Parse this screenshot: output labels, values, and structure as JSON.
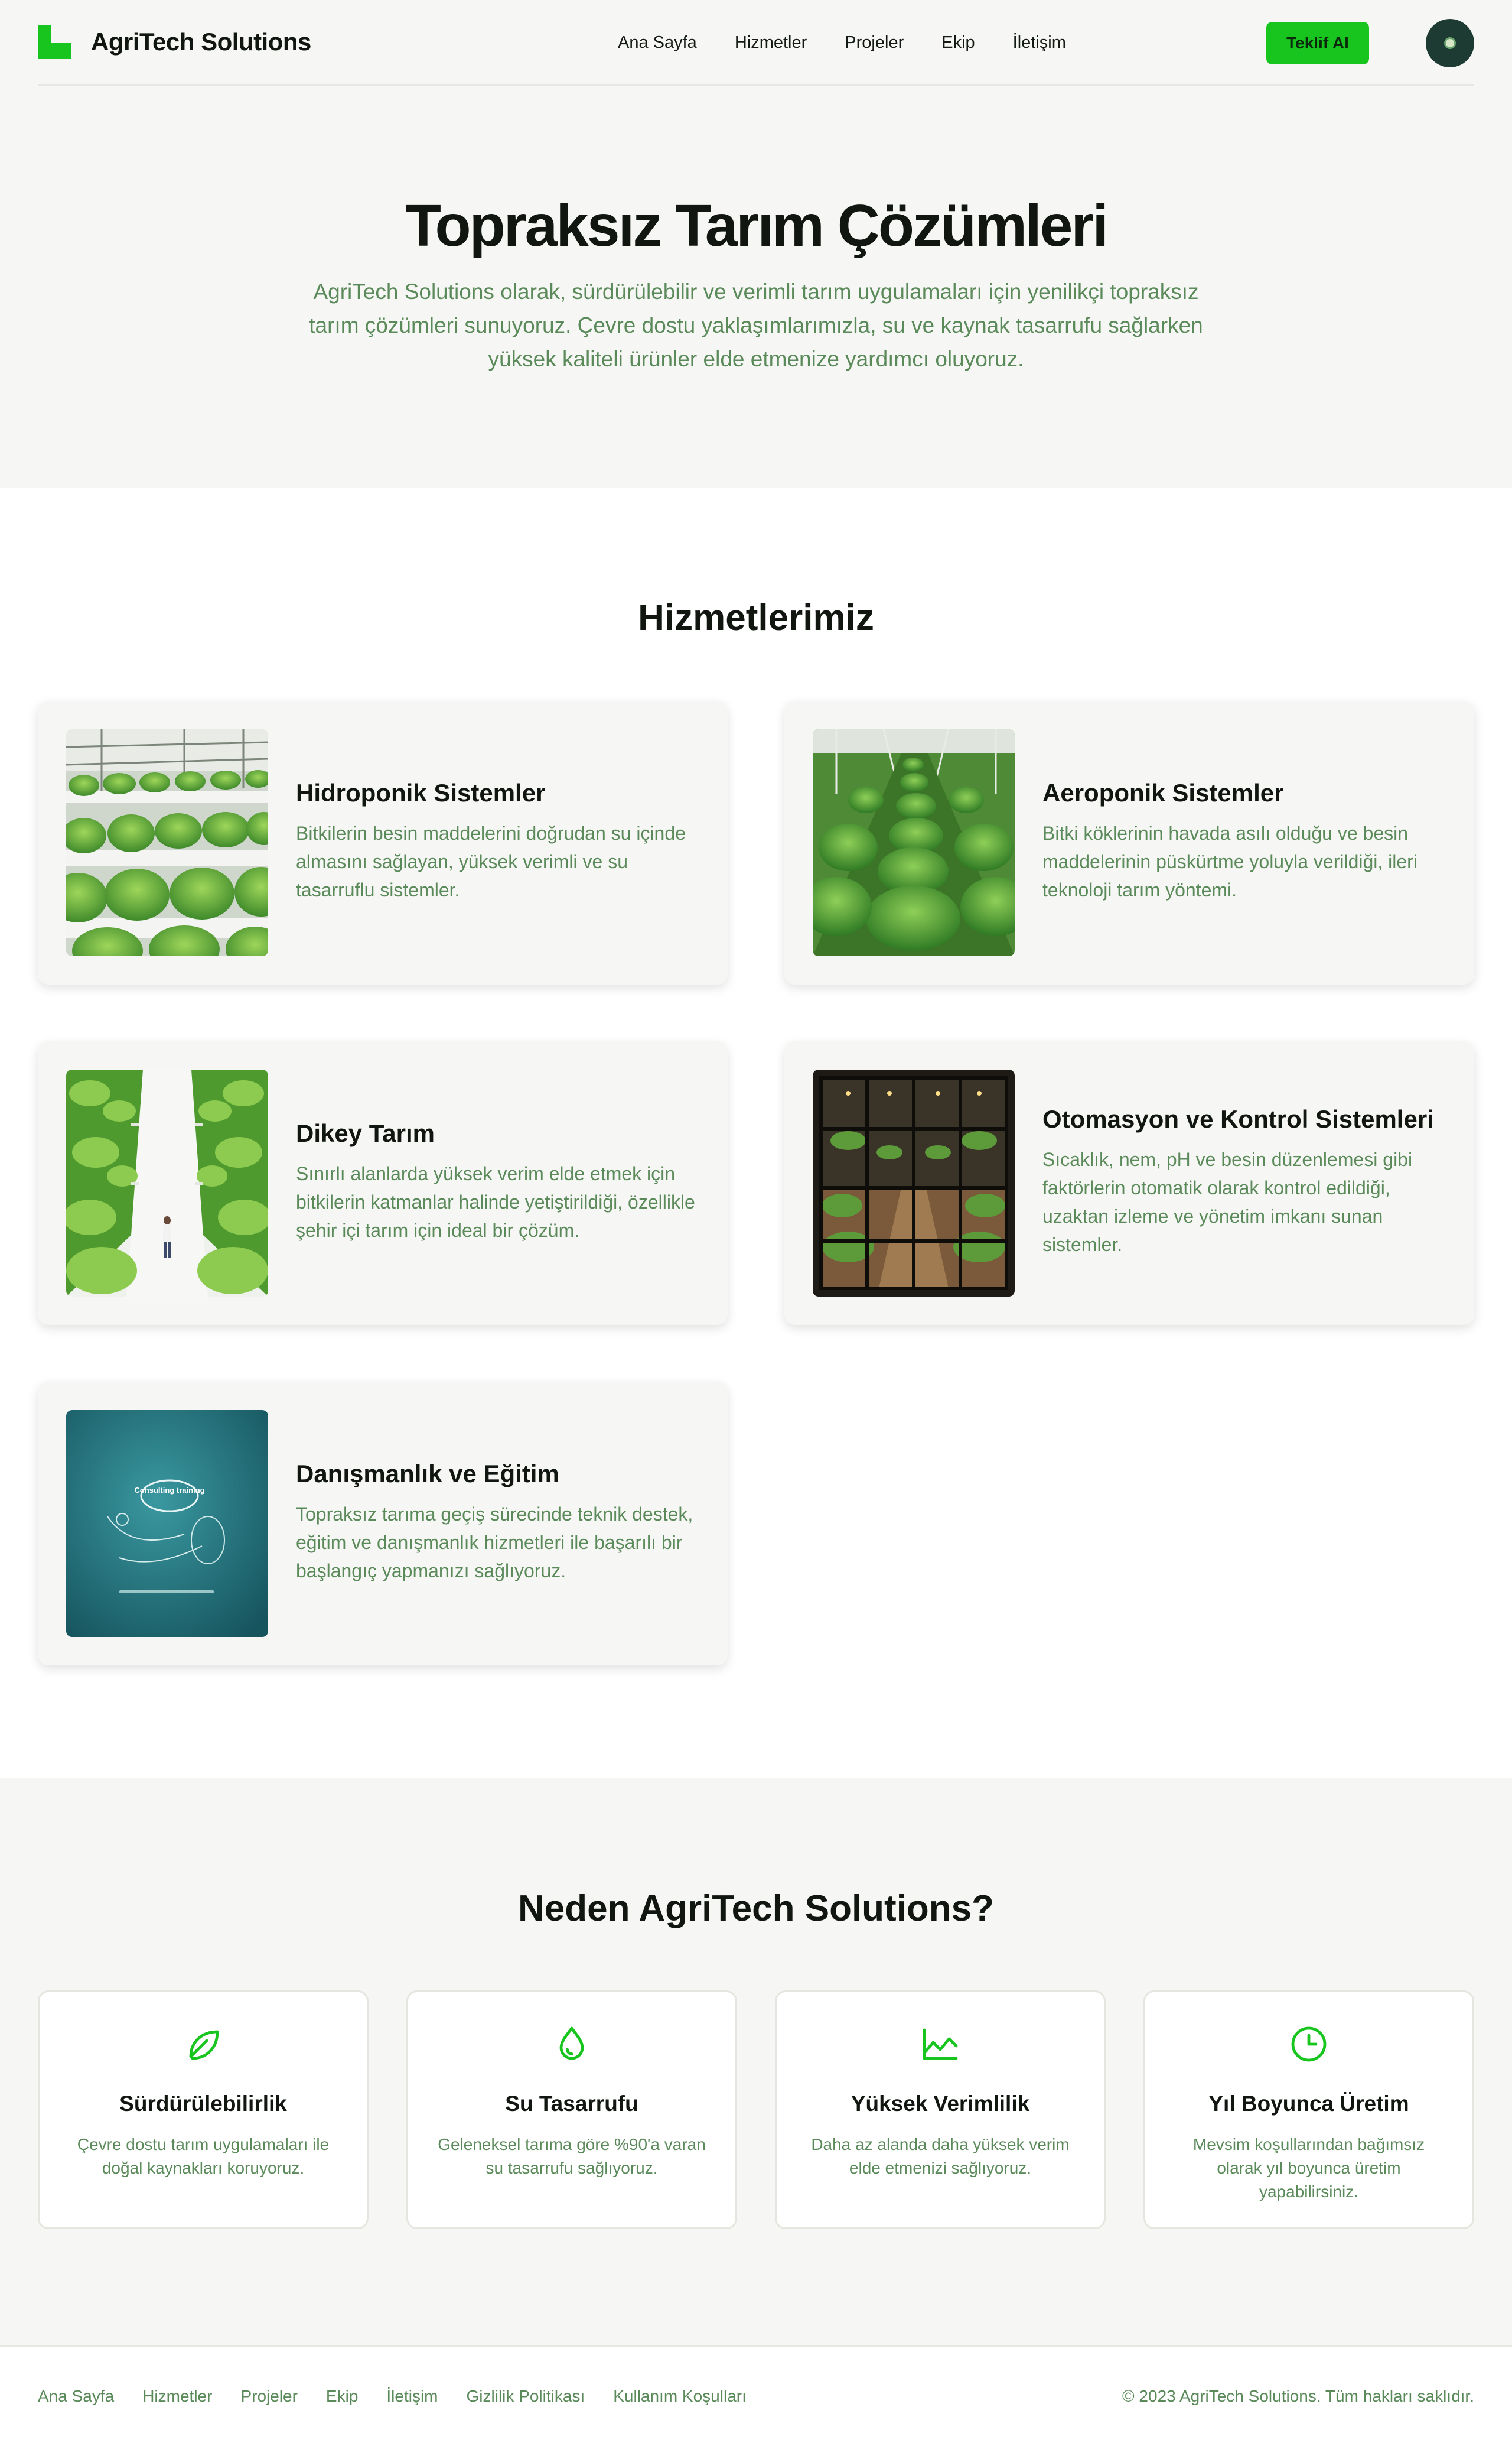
{
  "header": {
    "brand": "AgriTech Solutions",
    "nav": [
      "Ana Sayfa",
      "Hizmetler",
      "Projeler",
      "Ekip",
      "İletişim"
    ],
    "cta_label": "Teklif Al"
  },
  "hero": {
    "title": "Topraksız Tarım Çözümleri",
    "subtitle": "AgriTech Solutions olarak, sürdürülebilir ve verimli tarım uygulamaları için yenilikçi topraksız tarım çözümleri sunuyoruz. Çevre dostu yaklaşımlarımızla, su ve kaynak tasarrufu sağlarken yüksek kaliteli ürünler elde etmenize yardımcı oluyoruz."
  },
  "services": {
    "title": "Hizmetlerimiz",
    "items": [
      {
        "title": "Hidroponik Sistemler",
        "desc": "Bitkilerin besin maddelerini doğrudan su içinde almasını sağlayan, yüksek verimli ve su tasarruflu sistemler."
      },
      {
        "title": "Aeroponik Sistemler",
        "desc": "Bitki köklerinin havada asılı olduğu ve besin maddelerinin püskürtme yoluyla verildiği, ileri teknoloji tarım yöntemi."
      },
      {
        "title": "Dikey Tarım",
        "desc": "Sınırlı alanlarda yüksek verim elde etmek için bitkilerin katmanlar halinde yetiştirildiği, özellikle şehir içi tarım için ideal bir çözüm."
      },
      {
        "title": "Otomasyon ve Kontrol Sistemleri",
        "desc": "Sıcaklık, nem, pH ve besin düzenlemesi gibi faktörlerin otomatik olarak kontrol edildiği, uzaktan izleme ve yönetim imkanı sunan sistemler."
      },
      {
        "title": "Danışmanlık ve Eğitim",
        "desc": "Topraksız tarıma geçiş sürecinde teknik destek, eğitim ve danışmanlık hizmetleri ile başarılı bir başlangıç yapmanızı sağlıyoruz.",
        "image_text": "Consulting training"
      }
    ]
  },
  "why": {
    "title": "Neden AgriTech Solutions?",
    "items": [
      {
        "icon": "leaf-icon",
        "title": "Sürdürülebilirlik",
        "desc": "Çevre dostu tarım uygulamaları ile doğal kaynakları koruyoruz."
      },
      {
        "icon": "water-drop-icon",
        "title": "Su Tasarrufu",
        "desc": "Geleneksel tarıma göre %90'a varan su tasarrufu sağlıyoruz."
      },
      {
        "icon": "growth-chart-icon",
        "title": "Yüksek Verimlilik",
        "desc": "Daha az alanda daha yüksek verim elde etmenizi sağlıyoruz."
      },
      {
        "icon": "clock-icon",
        "title": "Yıl Boyunca Üretim",
        "desc": "Mevsim koşullarından bağımsız olarak yıl boyunca üretim yapabilirsiniz."
      }
    ]
  },
  "footer": {
    "links": [
      "Ana Sayfa",
      "Hizmetler",
      "Projeler",
      "Ekip",
      "İletişim",
      "Gizlilik Politikası",
      "Kullanım Koşulları"
    ],
    "copyright": "© 2023 AgriTech Solutions. Tüm hakları saklıdır."
  },
  "colors": {
    "accent": "#18c51f",
    "muted_text": "#5b8a5a",
    "surface": "#f6f7f4",
    "avatar": "#1d3b33"
  }
}
